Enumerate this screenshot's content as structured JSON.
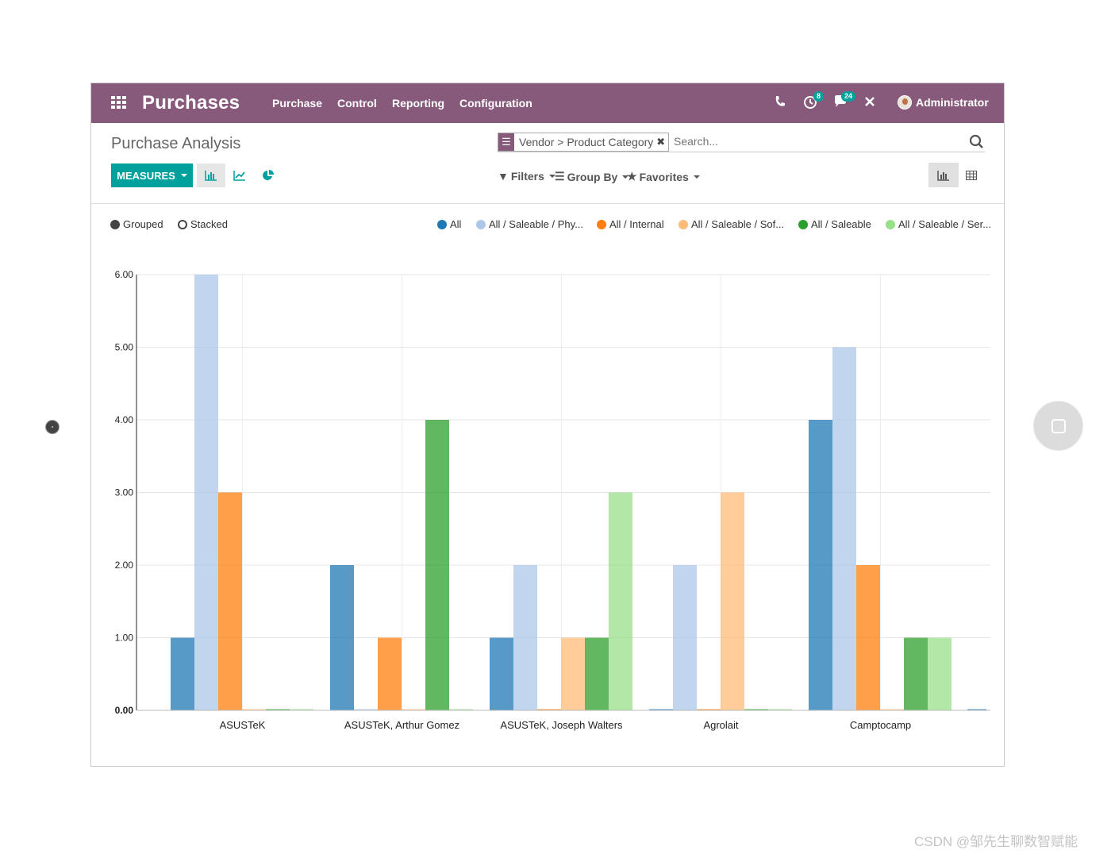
{
  "navbar": {
    "app_title": "Purchases",
    "menus": [
      "Purchase",
      "Control",
      "Reporting",
      "Configuration"
    ],
    "activity_badge": "8",
    "messages_badge": "24",
    "user_name": "Administrator",
    "bg_color": "#875a7b"
  },
  "control_panel": {
    "breadcrumb": "Purchase Analysis",
    "search_facet": "Vendor > Product Category",
    "search_placeholder": "Search...",
    "measures_label": "MEASURES",
    "filters_label": "Filters",
    "groupby_label": "Group By",
    "favorites_label": "Favorites",
    "accent_color": "#00a09d"
  },
  "chart_options": {
    "grouped_label": "Grouped",
    "stacked_label": "Stacked",
    "selected": "Grouped"
  },
  "chart_data": {
    "type": "bar",
    "categories": [
      "ASUSTeK",
      "ASUSTeK, Arthur Gomez",
      "ASUSTeK, Joseph Walters",
      "Agrolait",
      "Camptocamp"
    ],
    "series": [
      {
        "name": "All",
        "color": "#1f77b4",
        "values": [
          1,
          2,
          1,
          0,
          4
        ]
      },
      {
        "name": "All / Saleable / Phy...",
        "color": "#aec7e8",
        "values": [
          6,
          0,
          2,
          2,
          5
        ]
      },
      {
        "name": "All / Internal",
        "color": "#ff7f0e",
        "values": [
          3,
          1,
          0,
          0,
          2
        ]
      },
      {
        "name": "All / Saleable / Sof...",
        "color": "#ffbb78",
        "values": [
          0,
          0,
          1,
          3,
          0
        ]
      },
      {
        "name": "All / Saleable",
        "color": "#2ca02c",
        "values": [
          0,
          4,
          1,
          0,
          1
        ]
      },
      {
        "name": "All / Saleable / Ser...",
        "color": "#98df8a",
        "values": [
          0,
          0,
          3,
          0,
          1
        ]
      }
    ],
    "yticks": [
      "0.00",
      "1.00",
      "2.00",
      "3.00",
      "4.00",
      "5.00",
      "6.00"
    ],
    "ylim": [
      0,
      6
    ],
    "grid": true,
    "legend_position": "top-right"
  },
  "watermark": "CSDN @邹先生聊数智赋能"
}
